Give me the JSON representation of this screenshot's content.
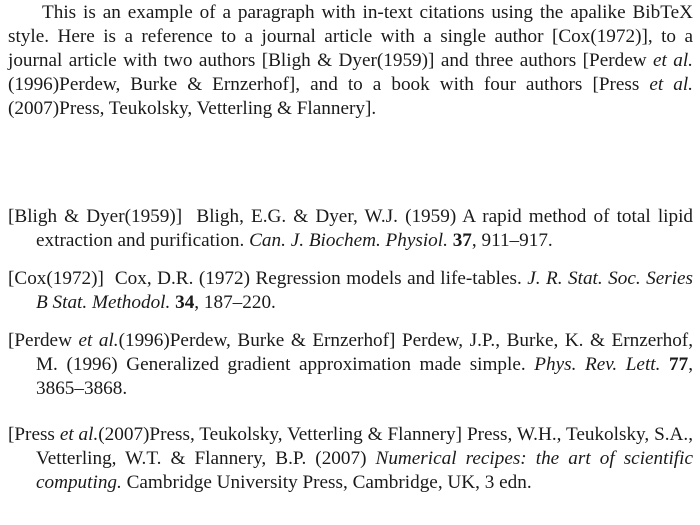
{
  "paragraph": {
    "parts": [
      {
        "text": "This is an example of a paragraph with in-text citations using the apalike BibTeX style.  Here is a reference to a journal article with a single author "
      },
      {
        "text": "[Cox(1972)]",
        "cite": "Cox(1972)"
      },
      {
        "text": ", to a journal article with two authors "
      },
      {
        "text": "[Bligh & Dyer(1959)]",
        "cite": "Bligh & Dyer(1959)"
      },
      {
        "text": " and three authors "
      },
      {
        "text": "[Perdew ",
        "cite": "Perdew et al.(1996)"
      },
      {
        "text": "et al.",
        "style": "italic"
      },
      {
        "text": "(1996)Perdew, Burke & Ernzerhof]"
      },
      {
        "text": ", and to a book with four authors "
      },
      {
        "text": "[Press "
      },
      {
        "text": "et al.",
        "style": "italic"
      },
      {
        "text": "(2007)Press, Teukolsky, Vetterling & Flannery]"
      },
      {
        "text": "."
      }
    ]
  },
  "bibliography": [
    {
      "key": "[Bligh & Dyer(1959)]",
      "parts": [
        {
          "text": "Bligh, E.G. & Dyer, W.J. (1959) A rapid method of total lipid extraction and purification. "
        },
        {
          "text": "Can. J. Biochem. Physiol.",
          "style": "italic"
        },
        {
          "text": " "
        },
        {
          "text": "37",
          "style": "bold"
        },
        {
          "text": ", 911–917."
        }
      ]
    },
    {
      "key": "[Cox(1972)]",
      "parts": [
        {
          "text": "Cox, D.R. (1972) Regression models and life-tables. "
        },
        {
          "text": "J. R. Stat. Soc. Series B Stat. Methodol.",
          "style": "italic"
        },
        {
          "text": " "
        },
        {
          "text": "34",
          "style": "bold"
        },
        {
          "text": ", 187–220."
        }
      ]
    },
    {
      "key_parts": [
        {
          "text": "[Perdew "
        },
        {
          "text": "et al.",
          "style": "italic"
        },
        {
          "text": "(1996)Perdew, Burke & Ernzerhof]"
        }
      ],
      "parts": [
        {
          "text": "Perdew, J.P., Burke, K. & Ernzerhof, M. (1996) Generalized gradient approximation made simple. "
        },
        {
          "text": "Phys. Rev. Lett.",
          "style": "italic"
        },
        {
          "text": " "
        },
        {
          "text": "77",
          "style": "bold"
        },
        {
          "text": ", 3865–3868."
        }
      ]
    },
    {
      "key_parts": [
        {
          "text": "[Press "
        },
        {
          "text": "et al.",
          "style": "italic"
        },
        {
          "text": "(2007)Press, Teukolsky, Vetterling & Flannery]"
        }
      ],
      "parts": [
        {
          "text": "Press, W.H., Teukolsky, S.A., Vetterling, W.T. & Flannery, B.P. (2007) "
        },
        {
          "text": "Numerical recipes: the art of scientific computing.",
          "style": "italic"
        },
        {
          "text": " Cambridge University Press, Cambridge, UK, 3 edn."
        }
      ]
    }
  ]
}
